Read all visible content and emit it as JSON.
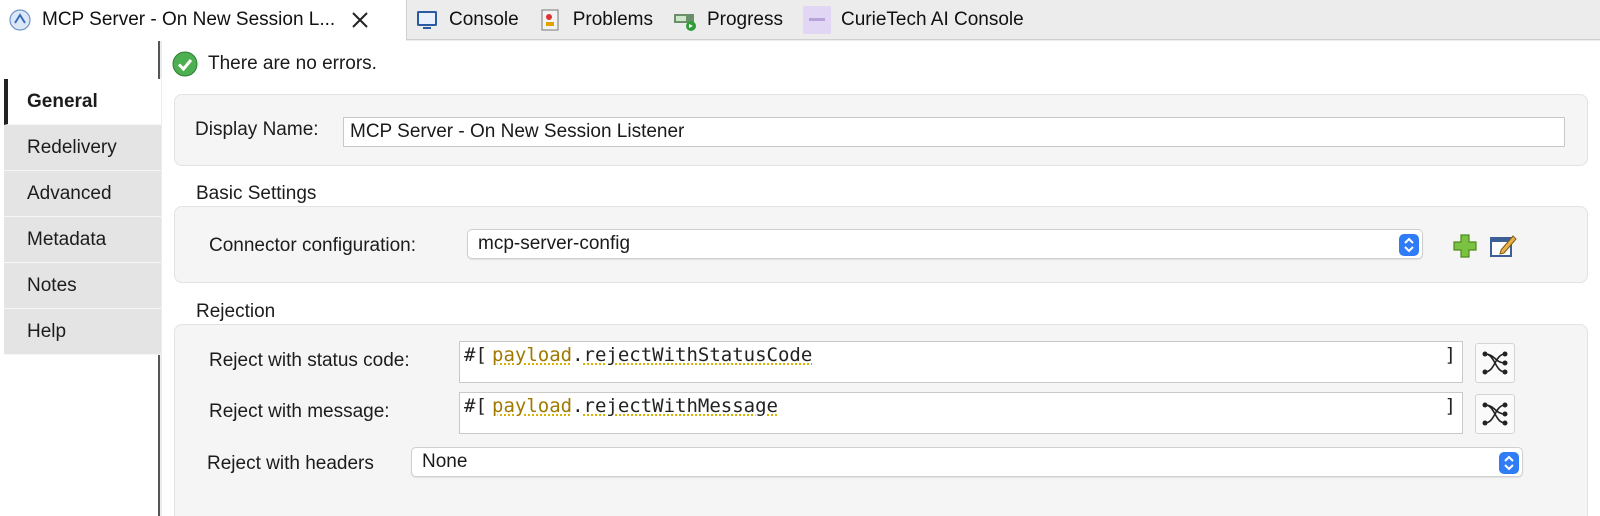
{
  "tabs": [
    {
      "label": "MCP Server - On New Session L...",
      "icon": "mule-flow-icon",
      "active": true
    },
    {
      "label": "Console",
      "icon": "console-icon"
    },
    {
      "label": "Problems",
      "icon": "problems-icon"
    },
    {
      "label": "Progress",
      "icon": "progress-icon"
    },
    {
      "label": "CurieTech AI Console",
      "icon": "curietech-icon"
    }
  ],
  "nav": {
    "items": [
      "General",
      "Redelivery",
      "Advanced",
      "Metadata",
      "Notes",
      "Help"
    ],
    "active": "General"
  },
  "status": {
    "text": "There are no errors.",
    "icon": "success-check-icon",
    "color": "#4caf50"
  },
  "general": {
    "display_name_label": "Display Name:",
    "display_name_value": "MCP Server - On New Session Listener"
  },
  "basic_settings": {
    "title": "Basic Settings",
    "connector_label": "Connector configuration:",
    "connector_value": "mcp-server-config"
  },
  "rejection": {
    "title": "Rejection",
    "status_code_label": "Reject with status code:",
    "status_code_open": "#[",
    "status_code_kw": "payload",
    "status_code_dot": ".",
    "status_code_fn": "rejectWithStatusCode",
    "status_code_close": "]",
    "message_label": "Reject with message:",
    "message_open": "#[",
    "message_kw": "payload",
    "message_dot": ".",
    "message_fn": "rejectWithMessage",
    "message_close": "]",
    "headers_label": "Reject with headers",
    "headers_value": "None"
  },
  "colors": {
    "accent": "#2f7cf6",
    "expr_keyword": "#a07a00"
  }
}
